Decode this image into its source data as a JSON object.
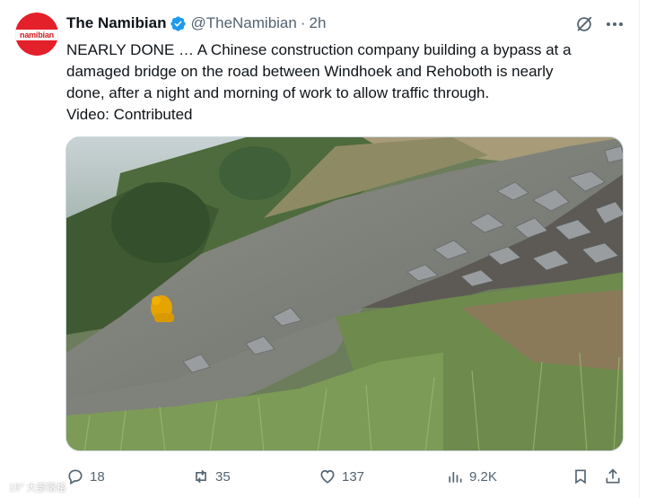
{
  "tweet": {
    "display_name": "The Namibian",
    "avatar_text": "namibian",
    "handle": "@TheNamibian",
    "separator": "·",
    "time": "2h",
    "text_lines": [
      "NEARLY DONE … A Chinese construction company building a bypass at a",
      "damaged bridge on the road between Windhoek and Rehoboth is nearly",
      "done, after a night and morning of work to allow traffic through.",
      "Video: Contributed"
    ]
  },
  "actions": {
    "replies": "18",
    "reposts": "35",
    "likes": "137",
    "views": "9.2K"
  },
  "icons": {
    "verified": "verified-badge-icon",
    "grok": "grok-icon",
    "more": "more-icon",
    "reply": "reply-icon",
    "repost": "repost-icon",
    "like": "heart-icon",
    "views": "views-chart-icon",
    "bookmark": "bookmark-icon",
    "share": "share-icon"
  },
  "colors": {
    "verified": "#1d9bf0",
    "muted": "#536471",
    "brand_red": "#e4202a"
  },
  "watermark": "15° 大部落格"
}
